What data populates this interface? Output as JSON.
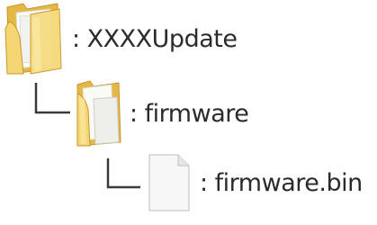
{
  "tree": {
    "root": {
      "label": ": XXXXUpdate",
      "icon": "folder-icon"
    },
    "firmware_folder": {
      "label": ": firmware",
      "icon": "folder-open-document-icon"
    },
    "firmware_file": {
      "label": ": firmware.bin",
      "icon": "file-icon"
    }
  },
  "colors": {
    "folder_front": "#f4d774",
    "folder_back": "#e5b845",
    "folder_outline": "#c9952e",
    "paper": "#f5f5f5",
    "connector": "#3a3a3a",
    "text": "#2b2b2b"
  }
}
